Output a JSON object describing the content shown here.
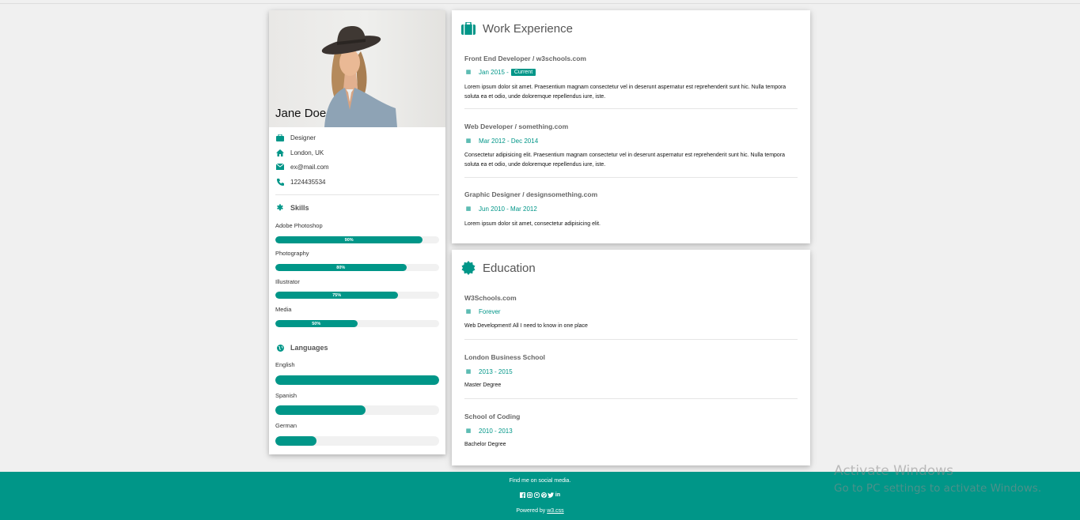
{
  "profile": {
    "name": "Jane Doe",
    "info": [
      {
        "icon": "briefcase-icon",
        "text": "Designer"
      },
      {
        "icon": "home-icon",
        "text": "London, UK"
      },
      {
        "icon": "envelope-icon",
        "text": "ex@mail.com"
      },
      {
        "icon": "phone-icon",
        "text": "1224435534"
      }
    ]
  },
  "skills": {
    "title": "Skills",
    "items": [
      {
        "name": "Adobe Photoshop",
        "percent": 90,
        "label": "90%"
      },
      {
        "name": "Photography",
        "percent": 80,
        "label": "80%"
      },
      {
        "name": "Illustrator",
        "percent": 75,
        "label": "75%"
      },
      {
        "name": "Media",
        "percent": 50,
        "label": "50%"
      }
    ]
  },
  "languages": {
    "title": "Languages",
    "items": [
      {
        "name": "English",
        "percent": 100
      },
      {
        "name": "Spanish",
        "percent": 55
      },
      {
        "name": "German",
        "percent": 25
      }
    ]
  },
  "work": {
    "title": "Work Experience",
    "entries": [
      {
        "title": "Front End Developer / w3schools.com",
        "date": "Jan 2015 -",
        "tag": "Current",
        "desc": "Lorem ipsum dolor sit amet. Praesentium magnam consectetur vel in deserunt aspernatur est reprehenderit sunt hic. Nulla tempora soluta ea et odio, unde doloremque repellendus iure, iste."
      },
      {
        "title": "Web Developer / something.com",
        "date": "Mar 2012 - Dec 2014",
        "tag": "",
        "desc": "Consectetur adipisicing elit. Praesentium magnam consectetur vel in deserunt aspernatur est reprehenderit sunt hic. Nulla tempora soluta ea et odio, unde doloremque repellendus iure, iste."
      },
      {
        "title": "Graphic Designer / designsomething.com",
        "date": "Jun 2010 - Mar 2012",
        "tag": "",
        "desc": "Lorem ipsum dolor sit amet, consectetur adipisicing elit."
      }
    ]
  },
  "education": {
    "title": "Education",
    "entries": [
      {
        "title": "W3Schools.com",
        "date": "Forever",
        "desc": "Web Development! All I need to know in one place"
      },
      {
        "title": "London Business School",
        "date": "2013 - 2015",
        "desc": "Master Degree"
      },
      {
        "title": "School of Coding",
        "date": "2010 - 2013",
        "desc": "Bachelor Degree"
      }
    ]
  },
  "footer": {
    "tagline": "Find me on social media.",
    "social": [
      "facebook-icon",
      "instagram-icon",
      "snapchat-icon",
      "pinterest-icon",
      "twitter-icon",
      "linkedin-icon"
    ],
    "powered_prefix": "Powered by",
    "powered_link": "w3.css"
  },
  "watermark": {
    "line1": "Activate Windows",
    "line2": "Go to PC settings to activate Windows."
  },
  "colors": {
    "accent": "#009688",
    "background": "#f0f0f0"
  }
}
